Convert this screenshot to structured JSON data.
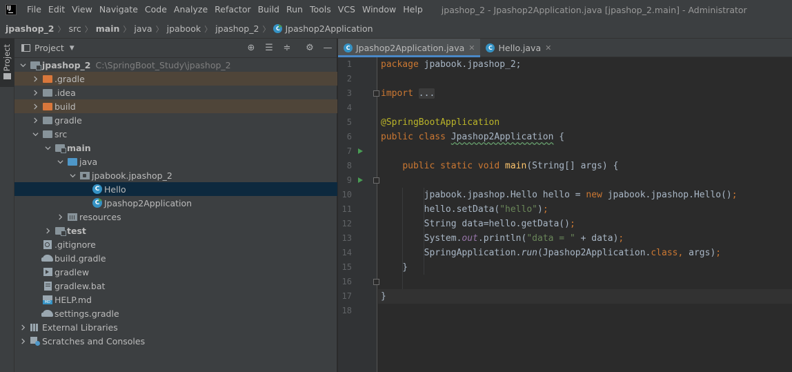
{
  "window_title": "jpashop_2 - Jpashop2Application.java [jpashop_2.main] - Administrator",
  "app_logo": "IJ",
  "menu": [
    "File",
    "Edit",
    "View",
    "Navigate",
    "Code",
    "Analyze",
    "Refactor",
    "Build",
    "Run",
    "Tools",
    "VCS",
    "Window",
    "Help"
  ],
  "breadcrumbs": [
    "jpashop_2",
    "src",
    "main",
    "java",
    "jpabook",
    "jpashop_2",
    "Jpashop2Application"
  ],
  "tool_strip": {
    "project_label": "Project"
  },
  "project_panel": {
    "title": "Project",
    "header_buttons": [
      "target-icon",
      "expand-all-icon",
      "collapse-all-icon",
      "gear-icon",
      "minimize-icon"
    ],
    "tree": [
      {
        "label": "jpashop_2",
        "hint": "C:\\SpringBoot_Study\\jpashop_2",
        "icon": "module-folder",
        "state": "expanded",
        "bold": true
      },
      {
        "label": ".gradle",
        "icon": "excluded-folder",
        "state": "collapsed",
        "highlight": "excluded"
      },
      {
        "label": ".idea",
        "icon": "folder",
        "state": "collapsed"
      },
      {
        "label": "build",
        "icon": "excluded-folder",
        "state": "collapsed",
        "highlight": "excluded"
      },
      {
        "label": "gradle",
        "icon": "folder",
        "state": "collapsed"
      },
      {
        "label": "src",
        "icon": "folder",
        "state": "expanded"
      },
      {
        "label": "main",
        "icon": "module-folder",
        "state": "expanded",
        "bold": true
      },
      {
        "label": "java",
        "icon": "source-folder",
        "state": "expanded"
      },
      {
        "label": "jpabook.jpashop_2",
        "icon": "package",
        "state": "expanded"
      },
      {
        "label": "Hello",
        "icon": "class",
        "state": "leaf",
        "selected": true
      },
      {
        "label": "Jpashop2Application",
        "icon": "runnable-class",
        "state": "leaf"
      },
      {
        "label": "resources",
        "icon": "resources-folder",
        "state": "collapsed"
      },
      {
        "label": "test",
        "icon": "module-folder",
        "state": "collapsed",
        "bold": true
      },
      {
        "label": ".gitignore",
        "icon": "gitignore-file",
        "state": "leaf"
      },
      {
        "label": "build.gradle",
        "icon": "gradle-file",
        "state": "leaf"
      },
      {
        "label": "gradlew",
        "icon": "shell-file",
        "state": "leaf"
      },
      {
        "label": "gradlew.bat",
        "icon": "bat-file",
        "state": "leaf"
      },
      {
        "label": "HELP.md",
        "icon": "markdown-file",
        "state": "leaf"
      },
      {
        "label": "settings.gradle",
        "icon": "gradle-file",
        "state": "leaf"
      },
      {
        "label": "External Libraries",
        "icon": "libraries",
        "state": "collapsed"
      },
      {
        "label": "Scratches and Consoles",
        "icon": "scratches",
        "state": "collapsed"
      }
    ]
  },
  "editor": {
    "tabs": [
      {
        "label": "Jpashop2Application.java",
        "active": true
      },
      {
        "label": "Hello.java",
        "active": false
      }
    ],
    "current_line": 17,
    "lines": [
      [
        [
          "kw",
          "package "
        ],
        [
          "plain",
          "jpabook.jpashop_2;"
        ]
      ],
      [],
      [
        [
          "kw",
          "import "
        ],
        [
          "fold",
          "..."
        ]
      ],
      [],
      [
        [
          "ann",
          "@SpringBootApplication"
        ]
      ],
      [
        [
          "kw",
          "public class "
        ],
        [
          "typo",
          "Jpashop2Application"
        ],
        [
          "plain",
          " {"
        ]
      ],
      [],
      [
        [
          "plain",
          "    "
        ],
        [
          "kw",
          "public static void "
        ],
        [
          "fn",
          "main"
        ],
        [
          "plain",
          "(String[] args) {"
        ]
      ],
      [],
      [
        [
          "plain",
          "        jpabook.jpashop.Hello hello = "
        ],
        [
          "kw",
          "new "
        ],
        [
          "plain",
          "jpabook.jpashop.Hello()"
        ],
        [
          "kw",
          ";"
        ]
      ],
      [
        [
          "plain",
          "        hello.setData("
        ],
        [
          "str",
          "\"hello\""
        ],
        [
          "plain",
          ")"
        ],
        [
          "kw",
          ";"
        ]
      ],
      [
        [
          "plain",
          "        String data=hello.getData()"
        ],
        [
          "kw",
          ";"
        ]
      ],
      [
        [
          "plain",
          "        System."
        ],
        [
          "static",
          "out"
        ],
        [
          "plain",
          ".println("
        ],
        [
          "str",
          "\"data = \""
        ],
        [
          "plain",
          " + data)"
        ],
        [
          "kw",
          ";"
        ]
      ],
      [
        [
          "plain",
          "        SpringApplication."
        ],
        [
          "italic",
          "run"
        ],
        [
          "plain",
          "(Jpashop2Application."
        ],
        [
          "kw",
          "class, "
        ],
        [
          "plain",
          "args)"
        ],
        [
          "kw",
          ";"
        ]
      ],
      [
        [
          "plain",
          "    }"
        ]
      ],
      [],
      [
        [
          "plain",
          "}"
        ]
      ],
      []
    ],
    "run_markers": [
      7,
      9
    ],
    "fold_markers": [
      3,
      9,
      16
    ],
    "indent_guides": [
      {
        "col": 4,
        "from": 10,
        "to": 16
      },
      {
        "col": 8,
        "from": 10,
        "to": 15
      }
    ]
  }
}
